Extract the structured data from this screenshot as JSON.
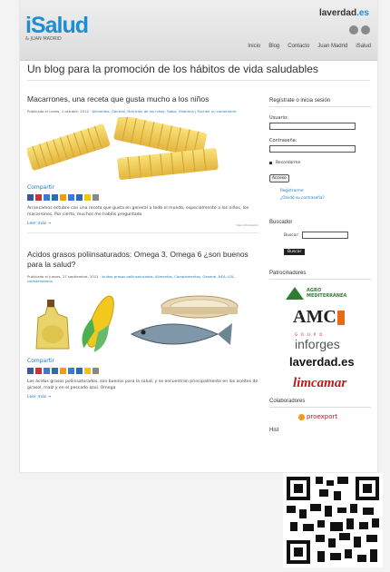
{
  "header": {
    "logo_text": "iSalud",
    "logo_subtitle": "& JUAN MADRID",
    "laverdad_text": "laverdad",
    "laverdad_tld": ".es",
    "nav": [
      "Inicio",
      "Blog",
      "Contacto",
      "Juan Madrid",
      "iSalud"
    ]
  },
  "blog_title": "Un blog para la promoción de los hábitos de vida saludables",
  "posts": [
    {
      "title": "Macarrones, una receta que gusta mucho a los niños",
      "meta_prefix": "Publicado el Lunes, 1 octubre, 2012",
      "meta_link": "Alimentos, General, Nutrición de los niños, Todos, Vitamina | Escribir un comentario",
      "share": "Compartir",
      "excerpt": "Arrancamos octubre con una receta que gusta en general a todo el mundo, especialmente a los niños, los macarrones. Por cierto, muchos me habéis preguntado",
      "read_more": "Leer más →",
      "footnote": "más información"
    },
    {
      "title": "Acidos grasos poliinsaturados: Omega 3, Omega 6 ¿son buenos para la salud?",
      "meta_prefix": "Publicado el Jueves, 27 septiembre, 2012",
      "meta_link": "ácidos grasos poliinsaturados, Alimentos, Complementos, General, NEA, LDL, colesterolemia",
      "share": "Compartir",
      "excerpt": "Los ácidos grasos poliinsaturados, son buenos para la salud, y se encuentran principalmente en los aceites de girasol, maíz y en el pescado azul. Omega",
      "read_more": "Leer más →"
    }
  ],
  "sidebar": {
    "login_heading": "Regístrate o inicia sesión",
    "user_label": "Usuario:",
    "password_label": "Contraseña:",
    "remember_label": "Recordarme",
    "login_button": "Acceso",
    "register_link": "Registrarme",
    "forgot_link": "¿Olvidó su contraseña?",
    "search_heading": "Buscador",
    "search_label": "Buscar:",
    "search_button": "Buscar",
    "sponsors_heading": "Patrocinadores",
    "sponsors": [
      "AGRO MEDITERRÁNEA",
      "AMC",
      "GRUPO",
      "inforges",
      "laverdad.es",
      "limcamar"
    ],
    "collaborators_heading": "Colaboradores",
    "collaborators": [
      "proexport"
    ],
    "partial_heading": "Hist"
  },
  "colors": {
    "brand_blue": "#1b8fd1",
    "link_blue": "#1b7ab8",
    "limcamar_red": "#c4161c",
    "agro_green": "#2e7d32"
  }
}
